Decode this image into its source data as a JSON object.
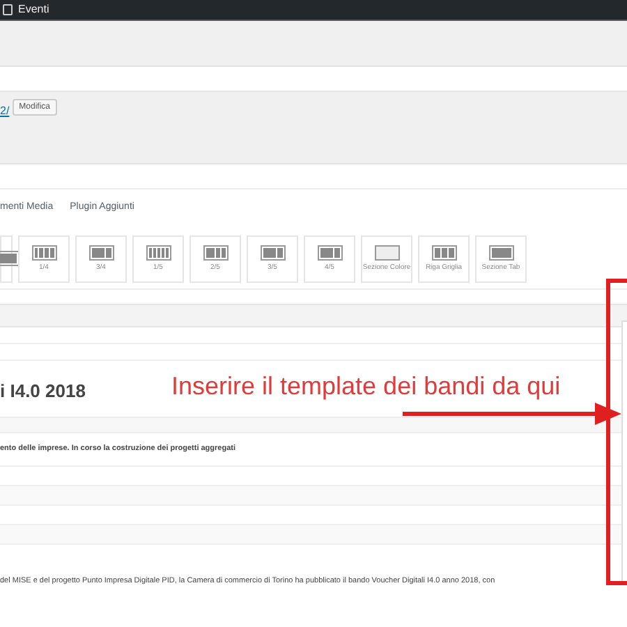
{
  "admin_bar": {
    "item": "Eventi"
  },
  "permalink": {
    "link": "2/",
    "button": "Modifica"
  },
  "tabs": [
    {
      "label": "menti Media",
      "selected": false
    },
    {
      "label": "Plugin Aggiunti",
      "selected": false
    }
  ],
  "layout_tools": [
    {
      "kind": "cut"
    },
    {
      "label": "1/4",
      "kind": "cols4"
    },
    {
      "label": "3/4",
      "kind": "wide"
    },
    {
      "label": "1/5",
      "kind": "cols5"
    },
    {
      "label": "2/5",
      "kind": "cols3"
    },
    {
      "label": "3/5",
      "kind": "wide"
    },
    {
      "label": "4/5",
      "kind": "wide"
    },
    {
      "label": "Sezione Colore",
      "kind": "section"
    },
    {
      "label": "Riga Griglia",
      "kind": "grid"
    },
    {
      "label": "Sezione Tab",
      "kind": "tab"
    }
  ],
  "post_title": "i I4.0 2018",
  "subtitle": "ento delle imprese. In corso la costruzione dei progetti aggregati",
  "body_text": "del MISE e del progetto Punto Impresa Digitale PID, la Camera di commercio di Torino ha pubblicato il bando Voucher Digitali I4.0 anno 2018, con",
  "annotation": {
    "text": "Inserire il template dei bandi da qui"
  }
}
